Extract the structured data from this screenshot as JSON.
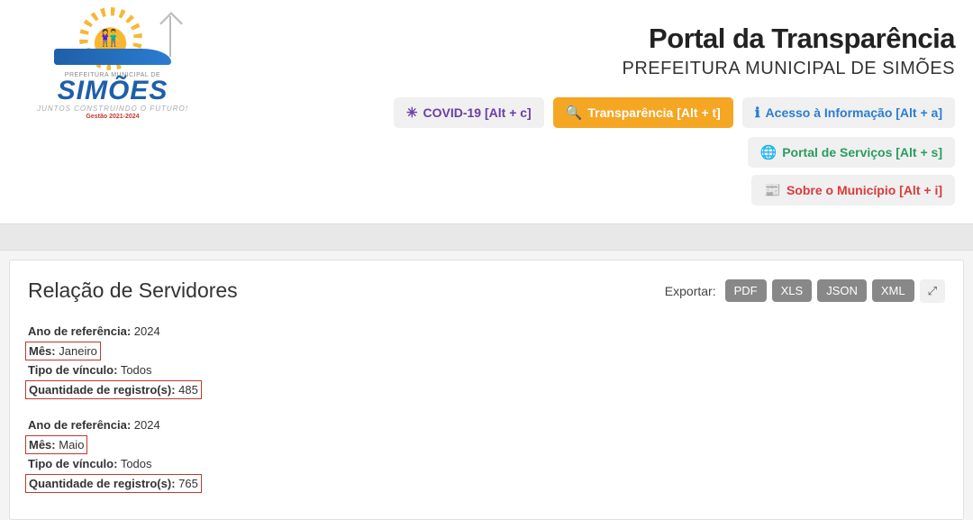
{
  "logo": {
    "top_text": "PREFEITURA MUNICIPAL DE",
    "main_text": "SIMÕES",
    "sub_text": "JUNTOS CONSTRUINDO O FUTURO!",
    "gest": "Gestão 2021-2024"
  },
  "header": {
    "title": "Portal da Transparência",
    "subtitle": "PREFEITURA MUNICIPAL DE SIMÕES"
  },
  "nav": {
    "covid": "COVID-19 [Alt + c]",
    "transparencia": "Transparência [Alt + t]",
    "acesso": "Acesso à Informação [Alt + a]",
    "portal_servicos": "Portal de Serviços [Alt + s]",
    "sobre": "Sobre o Município [Alt + i]"
  },
  "panel": {
    "title": "Relação de Servidores",
    "export_label": "Exportar:",
    "export_buttons": {
      "pdf": "PDF",
      "xls": "XLS",
      "json": "JSON",
      "xml": "XML"
    }
  },
  "blocks": [
    {
      "labels": {
        "ano": "Ano de referência:",
        "mes": "Mês:",
        "tipo": "Tipo de vínculo:",
        "qtd": "Quantidade de registro(s):"
      },
      "ano": "2024",
      "mes": "Janeiro",
      "tipo": "Todos",
      "qtd": "485"
    },
    {
      "labels": {
        "ano": "Ano de referência:",
        "mes": "Mês:",
        "tipo": "Tipo de vínculo:",
        "qtd": "Quantidade de registro(s):"
      },
      "ano": "2024",
      "mes": "Maio",
      "tipo": "Todos",
      "qtd": "765"
    }
  ]
}
